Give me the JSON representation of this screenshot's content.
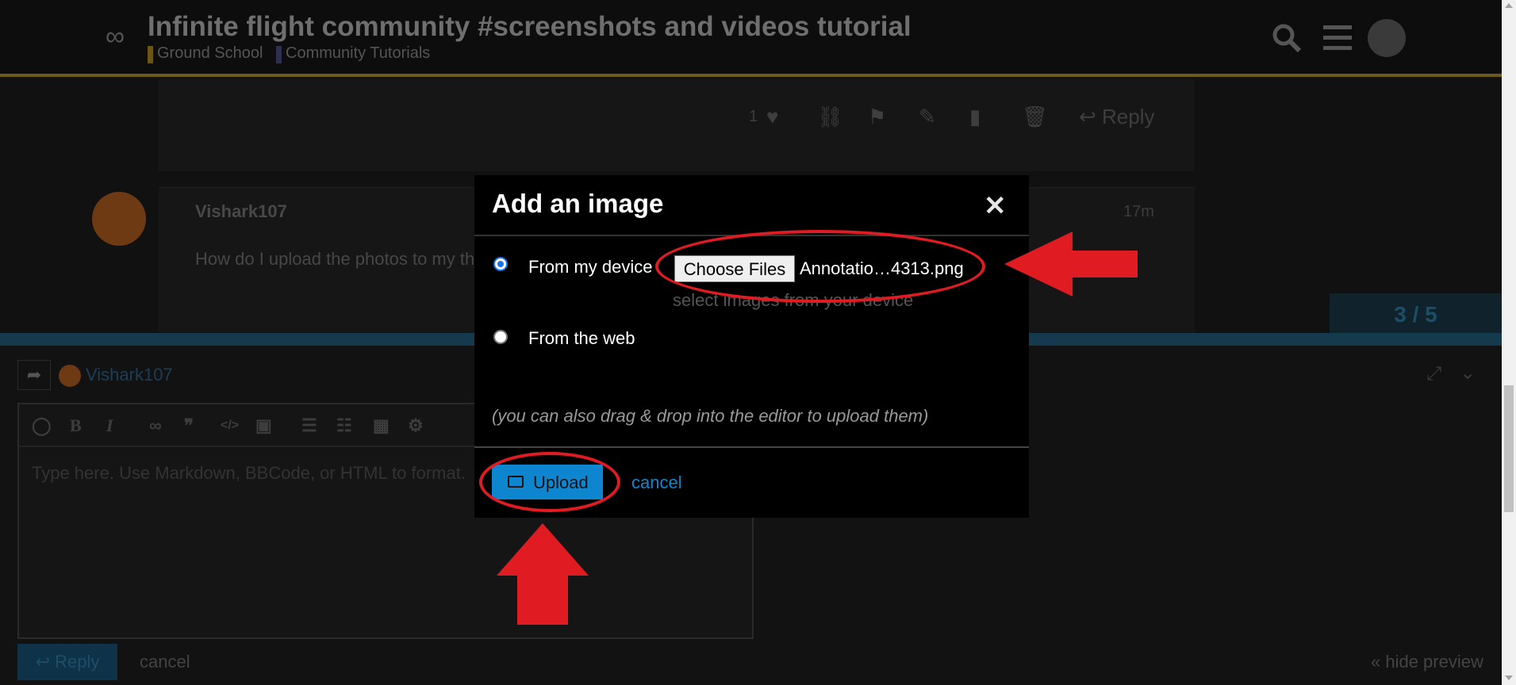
{
  "header": {
    "title": "Infinite flight community #screenshots and videos tutorial",
    "breadcrumbs": [
      "Ground School",
      "Community Tutorials"
    ],
    "logo_text": "∞",
    "icons": [
      "search-icon",
      "hamburger-menu-icon",
      "user-avatar"
    ]
  },
  "post_actions": {
    "like_count": "1",
    "reply_label": "Reply"
  },
  "post": {
    "username": "Vishark107",
    "time": "17m",
    "body": "How do I upload the photos to my th"
  },
  "progress": {
    "label": "3 / 5",
    "current": 3,
    "total": 5
  },
  "composer": {
    "username": "Vishark107",
    "placeholder": "Type here. Use Markdown, BBCode, or HTML to format.",
    "reply_label": "Reply",
    "cancel_label": "cancel",
    "hide_preview": "« hide preview"
  },
  "modal": {
    "title": "Add an image",
    "close_glyph": "✕",
    "option_device": "From my device",
    "option_web": "From the web",
    "selected_option": "device",
    "choose_files_label": "Choose Files",
    "file_name": "Annotatio…4313.png",
    "file_hint": "select images from your device",
    "drag_hint": "(you can also drag & drop into the editor to upload them)",
    "upload_label": "Upload",
    "cancel_label": "cancel"
  },
  "colors": {
    "accent": "#0e86cf",
    "annotation": "#e11b22",
    "modal_bg": "#000000",
    "page_bg": "#111111"
  }
}
